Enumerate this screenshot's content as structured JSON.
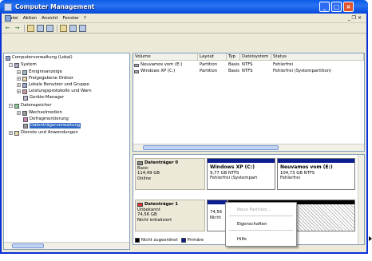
{
  "window": {
    "title": "Computer Management"
  },
  "menu": {
    "items": [
      "Datei",
      "Aktion",
      "Ansicht",
      "Fenster",
      "?"
    ],
    "restore": "_ ❐ ×"
  },
  "toolbar": {
    "back": "←",
    "forward": "→"
  },
  "tree": {
    "root": "Computerverwaltung (Lokal)",
    "system": "System",
    "events": "Ereignisanzeige",
    "shared": "Freigegebene Ordner",
    "users": "Lokale Benutzer und Gruppe",
    "perf": "Leistungsprotokolle und Warn",
    "devmgr": "Geräte-Manager",
    "storage": "Datenspeicher",
    "removable": "Wechselmedien",
    "defrag": "Defragmentierung",
    "diskmgmt": "Datenträgerverwaltung",
    "services": "Dienste und Anwendungen"
  },
  "list": {
    "headers": [
      "Volume",
      "Layout",
      "Typ",
      "Dateisystem",
      "Status"
    ],
    "rows": [
      {
        "volume": "Neuvamos vom (E:)",
        "layout": "Partition",
        "typ": "Basis",
        "fs": "NTFS",
        "status": "Fehlerfrei"
      },
      {
        "volume": "Windows XP (C:)",
        "layout": "Partition",
        "typ": "Basis",
        "fs": "NTFS",
        "status": "Fehlerfrei (Systempartition)"
      }
    ]
  },
  "disks": [
    {
      "title": "Datenträger 0",
      "type": "Basic",
      "size": "114,49 GB",
      "state": "Online"
    },
    {
      "title": "Datenträger 1",
      "type": "Unbekannt",
      "size": "74,56 GB",
      "state": "Nicht initialisiert"
    }
  ],
  "partitions": [
    {
      "name": "Windows XP (C:)",
      "size": "9,77 GB NTFS",
      "status": "Fehlerfrei (Systempart"
    },
    {
      "name": "Neuvamos vom (E:)",
      "size": "104,73 GB NTFS",
      "status": "Fehlerfrei"
    }
  ],
  "disk1_part": {
    "size": "74,56",
    "state": "Nicht"
  },
  "legend": {
    "unalloc": "Nicht zugeordnet",
    "primary": "Primäre"
  },
  "context_menu": {
    "items": [
      "Neue Partition...",
      "Eigenschaften",
      "Hilfe"
    ]
  },
  "colors": {
    "title_bar": "#0a5de8",
    "selection": "#316ac5",
    "partition_header": "#0b1d8f"
  }
}
